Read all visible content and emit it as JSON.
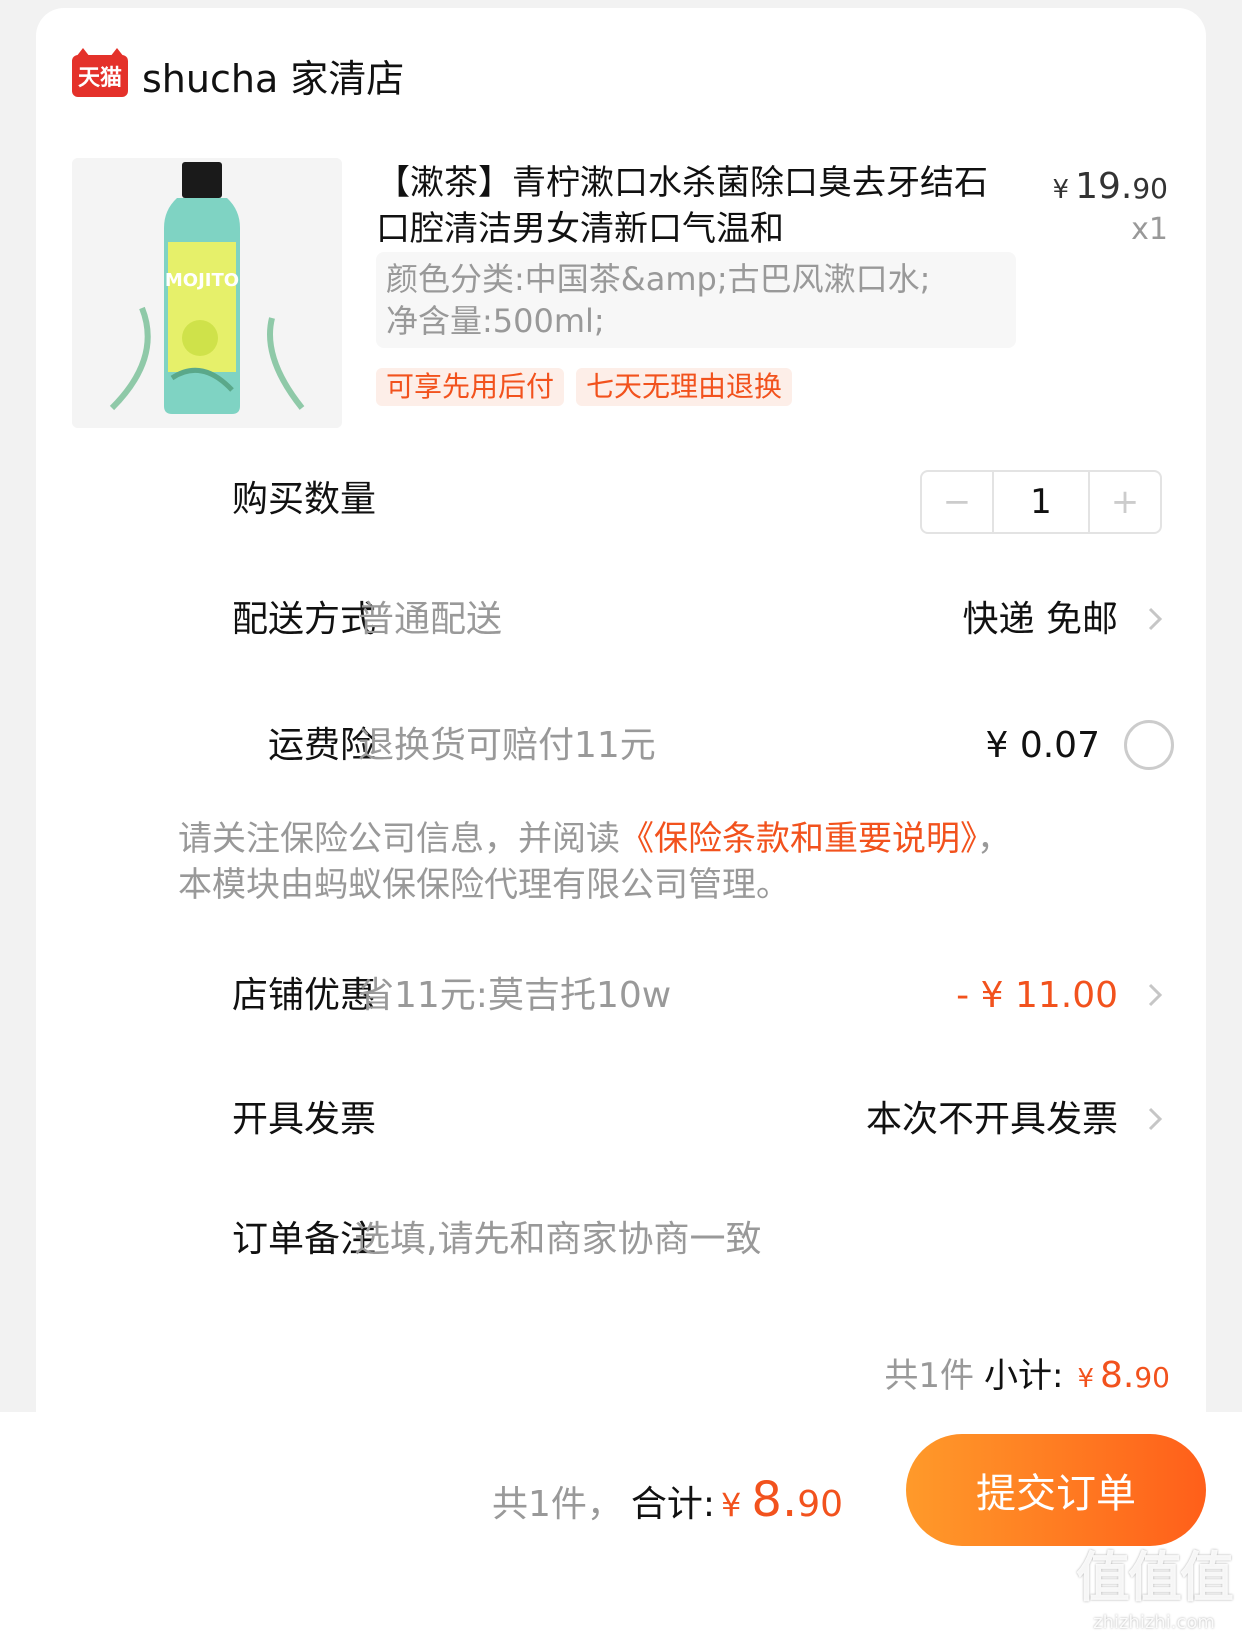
{
  "store": {
    "badge": "天猫",
    "name": "shucha 家清店"
  },
  "product": {
    "title": "【漱茶】青柠漱口水杀菌除口臭去牙结石口腔清洁男女清新口气温和",
    "price_yen": "¥",
    "price_int": "19.",
    "price_dec": "90",
    "qty": "x1",
    "sku_line1": "颜色分类:中国茶&amp;古巴风漱口水;",
    "sku_line2": "净含量:500ml;",
    "tags": [
      "可享先用后付",
      "七天无理由退换"
    ],
    "image_label": "MOJITO"
  },
  "quantity": {
    "label": "购买数量",
    "minus": "−",
    "value": "1",
    "plus": "+"
  },
  "delivery": {
    "label": "配送方式",
    "sub": "普通配送",
    "value": "快递 免邮"
  },
  "insurance": {
    "label": "运费险",
    "sub": "退换货可赔付11元",
    "value": "¥ 0.07"
  },
  "notice": {
    "prefix": "请关注保险公司信息，并阅读",
    "link": "《保险条款和重要说明》",
    "suffix": "，本模块由蚂蚁保保险代理有限公司管理。"
  },
  "discount": {
    "label": "店铺优惠",
    "sub": "省11元:莫吉托10w",
    "value": "- ¥ 11.00"
  },
  "invoice": {
    "label": "开具发票",
    "value": "本次不开具发票"
  },
  "remark": {
    "label": "订单备注",
    "placeholder": "选填,请先和商家协商一致"
  },
  "subtotal": {
    "count": "共1件",
    "label": "小计:",
    "yen": "¥",
    "int": "8.",
    "dec": "90"
  },
  "footer": {
    "count": "共1件，",
    "label": "合计:",
    "yen": "¥",
    "int": "8.",
    "dec": "90",
    "submit": "提交订单"
  },
  "watermark": {
    "big": "值值值",
    "small": "zhizhizhi.com"
  },
  "colors": {
    "accent": "#f2521d",
    "tmall_red": "#e4312a",
    "bottle": "#7fd3c3"
  }
}
